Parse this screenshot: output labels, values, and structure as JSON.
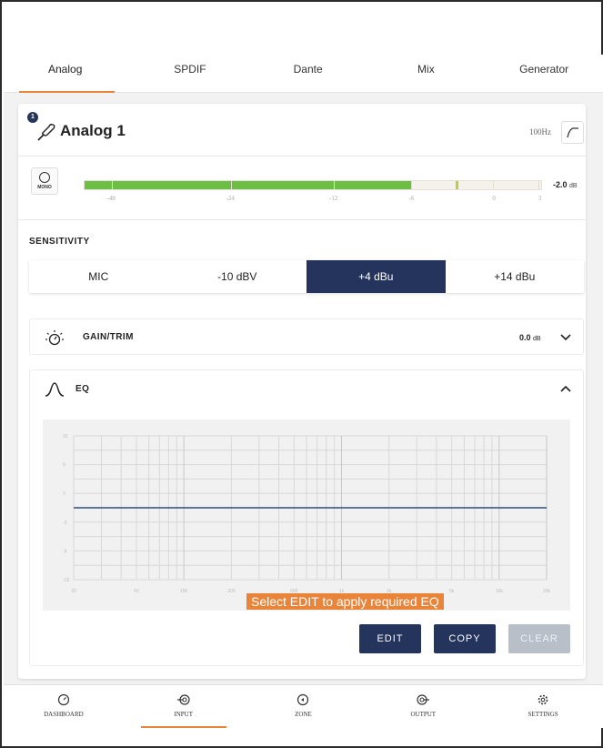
{
  "tabs": [
    {
      "label": "Analog",
      "active": true
    },
    {
      "label": "SPDIF",
      "active": false
    },
    {
      "label": "Dante",
      "active": false
    },
    {
      "label": "Mix",
      "active": false
    },
    {
      "label": "Generator",
      "active": false
    }
  ],
  "channel": {
    "badge": "1",
    "title": "Analog 1",
    "hpf_freq": "100Hz",
    "icon": "microphone-icon"
  },
  "meter": {
    "mono_label": "MONO",
    "level_fraction": 0.717,
    "peak_fraction": 0.812,
    "ticks": [
      "-48",
      "-24",
      "-12",
      "-6",
      "0",
      "3"
    ],
    "readout_value": "-2.0",
    "readout_unit": "dB",
    "fill_color": "#6cbe45"
  },
  "sensitivity": {
    "label": "SENSITIVITY",
    "options": [
      "MIC",
      "-10 dBV",
      "+4 dBu",
      "+14 dBu"
    ],
    "selected": "+4 dBu"
  },
  "gain": {
    "title": "GAIN/TRIM",
    "value": "0.0",
    "unit": "dB",
    "icon": "dial-icon",
    "expanded": false
  },
  "eq": {
    "title": "EQ",
    "icon": "eq-curve-icon",
    "expanded": true,
    "hint": "Select EDIT to apply required EQ",
    "buttons": {
      "edit": "EDIT",
      "copy": "COPY",
      "clear": "CLEAR"
    },
    "clear_enabled": false,
    "y_ticks": [
      "15",
      "12",
      "9",
      "6",
      "3",
      "0",
      "-3",
      "-6",
      "-9",
      "-12",
      "-15"
    ],
    "x_ticks": [
      "20",
      "50",
      "100",
      "200",
      "500",
      "1k",
      "2k",
      "5k",
      "10k",
      "20k"
    ],
    "flat_gain_db": 0,
    "line_color": "#2e4b7a"
  },
  "bottom_nav": [
    {
      "label": "DASHBOARD",
      "icon": "dashboard-icon",
      "active": false
    },
    {
      "label": "INPUT",
      "icon": "input-icon",
      "active": true
    },
    {
      "label": "ZONE",
      "icon": "zone-icon",
      "active": false
    },
    {
      "label": "OUTPUT",
      "icon": "output-icon",
      "active": false
    },
    {
      "label": "SETTINGS",
      "icon": "settings-icon",
      "active": false
    }
  ],
  "colors": {
    "accent": "#e8853b",
    "primary": "#24345c",
    "disabled": "#b8bfc9"
  }
}
